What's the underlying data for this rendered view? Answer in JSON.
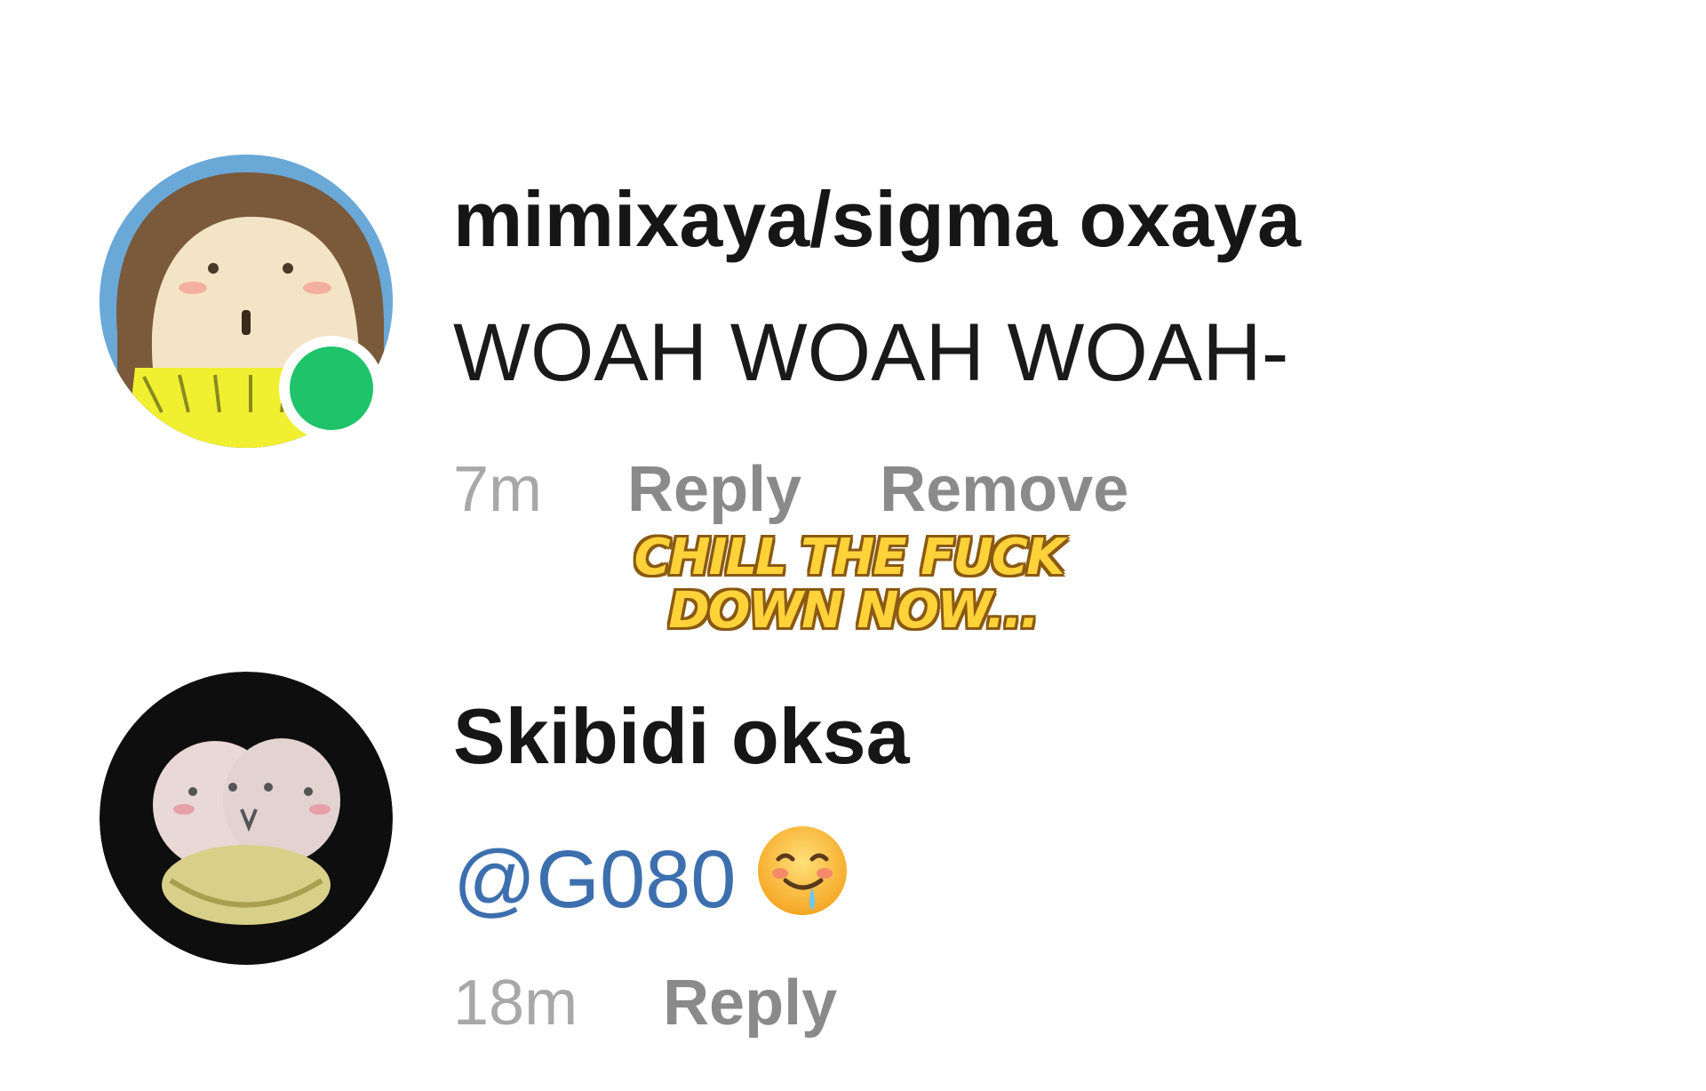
{
  "comments": [
    {
      "username": "mimixaya/sigma oxaya",
      "text": "WOAH WOAH WOAH-",
      "time": "7m",
      "reply_label": "Reply",
      "remove_label": "Remove",
      "online": true,
      "status_color": "#1ec36a"
    },
    {
      "username": "Skibidi oksa",
      "mention": "@G080",
      "emoji": "drooling-face-emoji",
      "time": "18m",
      "reply_label": "Reply"
    }
  ],
  "caption": {
    "line1": "CHILL THE FUCK",
    "line2": "DOWN NOW...",
    "color": "#ffd23a"
  },
  "colors": {
    "mention": "#3d6fae",
    "online": "#1ec36a"
  }
}
